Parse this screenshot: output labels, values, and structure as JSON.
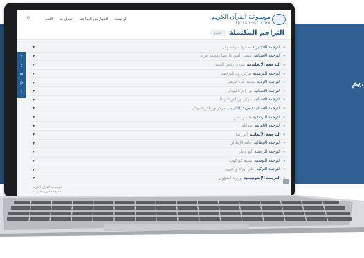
{
  "site": {
    "logo_ar": "موسوعة القرآن الكريم",
    "logo_en": "QuranEnc.com",
    "nav": [
      "الرئيسة",
      "الفهارس التراجم",
      "اتصل بنا",
      "اللغة"
    ],
    "page_title": "التراجم المكتملة",
    "title_sub": "جميع"
  },
  "band_text": "يم،",
  "social": [
    "f",
    "t",
    "w",
    "p",
    "+"
  ],
  "translations": [
    {
      "title": "الترجمة الإنجليزية",
      "author": "صحيح انترناشونال",
      "bold": false
    },
    {
      "title": "الترجمة الإسبانية",
      "author": "عيسى أمين غارسيا ومحمد عزام",
      "bold": false
    },
    {
      "title": "الترجمة الإنجليزية",
      "author": "مجدي رياض السيد",
      "bold": true
    },
    {
      "title": "الترجمة الفرنسية",
      "author": "مركز رواد الترجمة",
      "bold": false
    },
    {
      "title": "الترجمة الأردية",
      "author": "محمد جونا جرهي",
      "bold": false
    },
    {
      "title": "الترجمة الإسبانية",
      "author": "نور إنترناشونال",
      "bold": false
    },
    {
      "title": "الترجمة الإسبانية",
      "author": "مركز نور انترناشونال",
      "bold": false
    },
    {
      "title": "الترجمة الإسبانية (أمريكا اللاتينية)",
      "author": "مركز نور انترناشونال",
      "bold": false
    },
    {
      "title": "الترجمة البرتغالية",
      "author": "حلمي نصر",
      "bold": false
    },
    {
      "title": "الترجمة الألمانية",
      "author": "عبدالله",
      "bold": false
    },
    {
      "title": "الترجمة الألمانية",
      "author": "أبو رضا",
      "bold": true
    },
    {
      "title": "الترجمة الإيطالية",
      "author": "حامد الإيطالي",
      "bold": false
    },
    {
      "title": "الترجمة الروسية",
      "author": "أبو عادل",
      "bold": false
    },
    {
      "title": "الترجمة البوسنية",
      "author": "بسيم كوركوت",
      "bold": false
    },
    {
      "title": "الترجمة التركية",
      "author": "علي أوزك وآخرون",
      "bold": false
    },
    {
      "title": "الترجمة الإندونيسية",
      "author": "وزارة الشؤون",
      "bold": true
    }
  ],
  "footer_note": [
    "موسوعة القرآن الكريم",
    "جميع الحقوق محفوظة"
  ],
  "colors": {
    "band": "#2f5f93",
    "title": "#1e5b93",
    "screen_bg": "#f3f4f6"
  }
}
